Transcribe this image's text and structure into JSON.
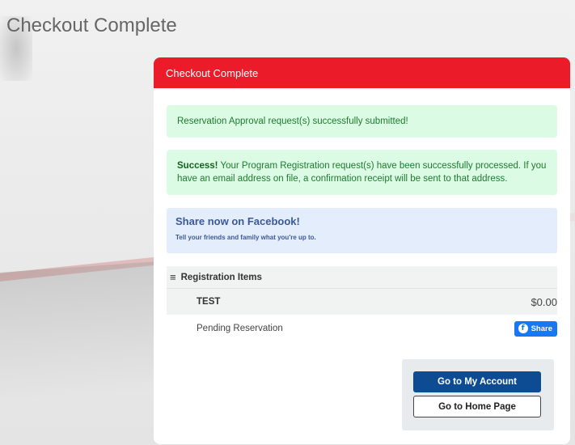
{
  "page": {
    "title": "Checkout Complete"
  },
  "panel": {
    "header": "Checkout Complete"
  },
  "alerts": {
    "reservation": "Reservation Approval request(s) successfully submitted!",
    "success_label": "Success!",
    "success_text": " Your Program Registration request(s) have been successfully processed. If you have an email address on file, a confirmation receipt will be sent to that address."
  },
  "facebook": {
    "title": "Share now on Facebook!",
    "subtitle": "Tell your friends and family what you're up to.",
    "share_label": "Share",
    "icon": "facebook-icon"
  },
  "registration": {
    "header": "Registration Items",
    "header_icon": "menu-icon",
    "items": [
      {
        "name": "TEST",
        "price": "$0.00",
        "status": "Pending Reservation"
      }
    ]
  },
  "actions": {
    "my_account": "Go to My Account",
    "home_page": "Go to Home Page"
  },
  "colors": {
    "header_red": "#ec1b2a",
    "success_bg": "#dcfbe4",
    "facebook_blue": "#1877f2",
    "primary_blue": "#0d4c93"
  }
}
